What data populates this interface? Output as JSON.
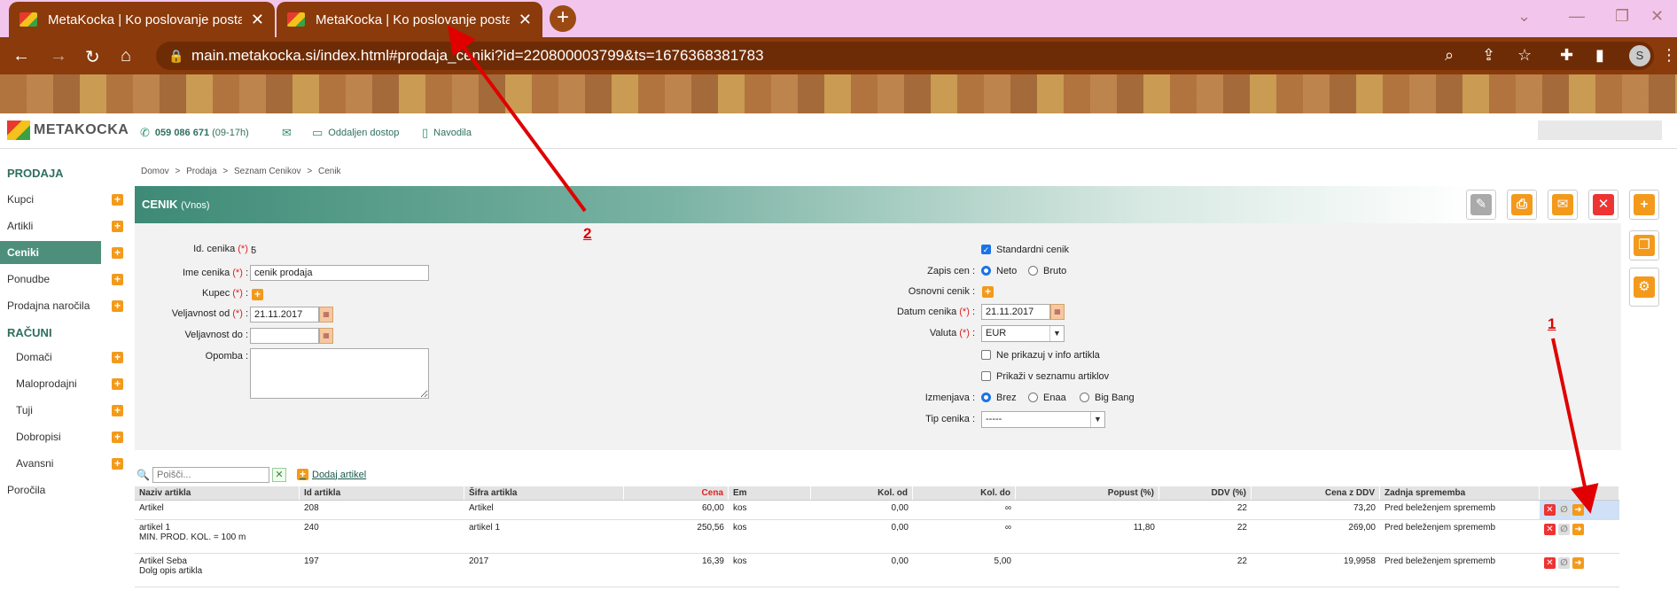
{
  "browser": {
    "tabs": [
      {
        "title": "MetaKocka | Ko poslovanje posta"
      },
      {
        "title": "MetaKocka | Ko poslovanje posta"
      }
    ],
    "url": "main.metakocka.si/index.html#prodaja_ceniki?id=220800003799&ts=1676368381783",
    "avatar_letter": "S"
  },
  "header": {
    "logo_text": "METAKOCKA",
    "phone": "059 086 671",
    "phone_hours": "(09-17h)",
    "remote": "Oddaljen dostop",
    "guide": "Navodila"
  },
  "sidebar": {
    "section1": "PRODAJA",
    "items1": [
      "Kupci",
      "Artikli",
      "Ceniki",
      "Ponudbe",
      "Prodajna naročila"
    ],
    "section2": "RAČUNI",
    "items2": [
      "Domači",
      "Maloprodajni",
      "Tuji",
      "Dobropisi",
      "Avansni"
    ],
    "reports": "Poročila"
  },
  "breadcrumb": [
    "Domov",
    ">",
    "Prodaja",
    ">",
    "Seznam Cenikov",
    ">",
    "Cenik"
  ],
  "page": {
    "title": "CENIK",
    "subtitle": "(Vnos)"
  },
  "form": {
    "id_label": "Id. cenika",
    "id_value": "5",
    "name_label": "Ime cenika",
    "name_value": "cenik prodaja",
    "buyer_label": "Kupec",
    "valid_from_label": "Veljavnost od",
    "valid_from_value": "21.11.2017",
    "valid_to_label": "Veljavnost do",
    "valid_to_value": "",
    "note_label": "Opomba",
    "std_label": "Standardni cenik",
    "record_label": "Zapis cen",
    "neto": "Neto",
    "bruto": "Bruto",
    "base_label": "Osnovni cenik",
    "date_label": "Datum cenika",
    "date_value": "21.11.2017",
    "currency_label": "Valuta",
    "currency_value": "EUR",
    "no_info": "Ne prikazuj v info artikla",
    "show_list": "Prikaži v seznamu artiklov",
    "exchange_label": "Izmenjava",
    "ex_opts": [
      "Brez",
      "Enaa",
      "Big Bang"
    ],
    "type_label": "Tip cenika",
    "type_value": "-----",
    "req": "(*)",
    "colon": ":"
  },
  "list": {
    "search_placeholder": "Poišči...",
    "add_article": "Dodaj artikel",
    "headers": [
      "Naziv artikla",
      "Id artikla",
      "Šifra artikla",
      "Cena",
      "Em",
      "Kol. od",
      "Kol. do",
      "Popust (%)",
      "DDV (%)",
      "Cena z DDV",
      "Zadnja sprememba"
    ],
    "rows": [
      {
        "name": "Artikel",
        "sub": "",
        "id": "208",
        "code": "Artikel",
        "price": "60,00",
        "em": "kos",
        "from": "0,00",
        "to": "∞",
        "disc": "",
        "vat": "22",
        "gross": "73,20",
        "last": "Pred beleženjem sprememb"
      },
      {
        "name": "artikel 1",
        "sub": "MIN. PROD. KOL. = 100 m",
        "id": "240",
        "code": "artikel 1",
        "price": "250,56",
        "em": "kos",
        "from": "0,00",
        "to": "∞",
        "disc": "11,80",
        "vat": "22",
        "gross": "269,00",
        "last": "Pred beleženjem sprememb"
      },
      {
        "name": "Artikel Seba",
        "sub": "Dolg opis artikla",
        "id": "197",
        "code": "2017",
        "price": "16,39",
        "em": "kos",
        "from": "0,00",
        "to": "5,00",
        "disc": "",
        "vat": "22",
        "gross": "19,9958",
        "last": "Pred beleženjem sprememb"
      }
    ]
  },
  "annotations": [
    "1",
    "2"
  ],
  "colors": {
    "accent": "#4e8f7c",
    "orange": "#f39a1c",
    "arrow": "#e00000"
  }
}
